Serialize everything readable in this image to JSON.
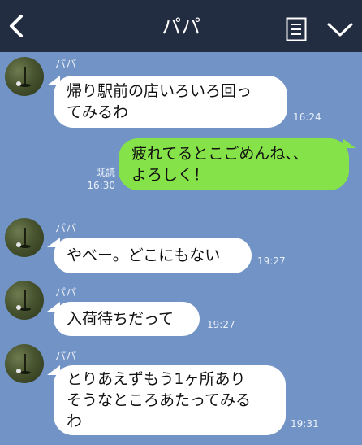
{
  "header": {
    "title": "パパ",
    "back_icon": "chevron-left-icon",
    "notes_icon": "notes-icon",
    "menu_icon": "chevron-down-icon",
    "background": "#232d41"
  },
  "chat": {
    "background": "#7293c5",
    "incoming_bubble_color": "#ffffff",
    "outgoing_bubble_color": "#85e249",
    "messages": [
      {
        "direction": "incoming",
        "sender": "パパ",
        "text": "帰り駅前の店いろいろ回っ\nてみるわ",
        "time": "16:24"
      },
      {
        "direction": "outgoing",
        "text": "疲れてるとこごめんね、、\nよろしく！",
        "read": "既読",
        "time": "16:30"
      },
      {
        "direction": "incoming",
        "sender": "パパ",
        "text": "やべー。どこにもない",
        "time": "19:27"
      },
      {
        "direction": "incoming",
        "sender": "パパ",
        "text": "入荷待ちだって",
        "time": "19:27"
      },
      {
        "direction": "incoming",
        "sender": "パパ",
        "text": "とりあえずもう1ヶ所あり\nそうなところあたってみる\nわ",
        "time": "19:31"
      }
    ]
  }
}
